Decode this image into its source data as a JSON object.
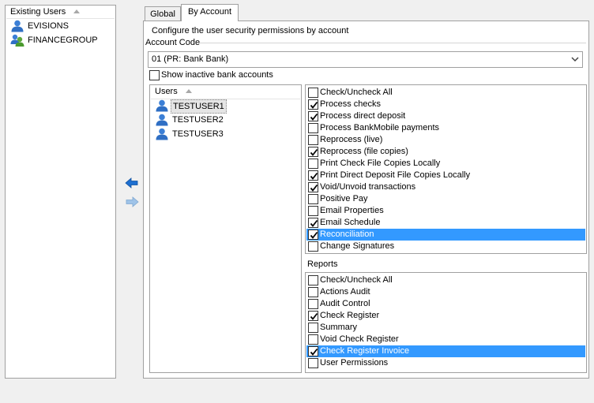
{
  "existing_users": {
    "header": "Existing Users",
    "items": [
      {
        "label": "EVISIONS",
        "type": "user-icon"
      },
      {
        "label": "FINANCEGROUP",
        "type": "group-icon"
      }
    ]
  },
  "tabs": [
    {
      "label": "Global",
      "active": false
    },
    {
      "label": "By Account",
      "active": true
    }
  ],
  "description": "Configure the user security permissions by account",
  "account_code": {
    "label": "Account Code",
    "value": "01 (PR: Bank Bank)"
  },
  "show_inactive": {
    "label": "Show inactive bank accounts",
    "checked": false
  },
  "users": {
    "header": "Users",
    "items": [
      {
        "label": "TESTUSER1",
        "selected": true
      },
      {
        "label": "TESTUSER2",
        "selected": false
      },
      {
        "label": "TESTUSER3",
        "selected": false
      }
    ]
  },
  "permissions": [
    {
      "label": "Check/Uncheck All",
      "checked": false,
      "selected": false
    },
    {
      "label": "Process checks",
      "checked": true,
      "selected": false
    },
    {
      "label": "Process direct deposit",
      "checked": true,
      "selected": false
    },
    {
      "label": "Process BankMobile payments",
      "checked": false,
      "selected": false
    },
    {
      "label": "Reprocess (live)",
      "checked": false,
      "selected": false
    },
    {
      "label": "Reprocess (file copies)",
      "checked": true,
      "selected": false
    },
    {
      "label": "Print Check File Copies Locally",
      "checked": false,
      "selected": false
    },
    {
      "label": "Print Direct Deposit File Copies Locally",
      "checked": true,
      "selected": false
    },
    {
      "label": "Void/Unvoid transactions",
      "checked": true,
      "selected": false
    },
    {
      "label": "Positive Pay",
      "checked": false,
      "selected": false
    },
    {
      "label": "Email Properties",
      "checked": false,
      "selected": false
    },
    {
      "label": "Email Schedule",
      "checked": true,
      "selected": false
    },
    {
      "label": "Reconciliation",
      "checked": true,
      "selected": true
    },
    {
      "label": "Change Signatures",
      "checked": false,
      "selected": false
    }
  ],
  "reports": {
    "label": "Reports",
    "items": [
      {
        "label": "Check/Uncheck All",
        "checked": false,
        "selected": false
      },
      {
        "label": "Actions Audit",
        "checked": false,
        "selected": false
      },
      {
        "label": "Audit Control",
        "checked": false,
        "selected": false
      },
      {
        "label": "Check Register",
        "checked": true,
        "selected": false
      },
      {
        "label": "Summary",
        "checked": false,
        "selected": false
      },
      {
        "label": "Void Check Register",
        "checked": false,
        "selected": false
      },
      {
        "label": "Check Register Invoice",
        "checked": true,
        "selected": true
      },
      {
        "label": "User Permissions",
        "checked": false,
        "selected": false
      }
    ]
  },
  "colors": {
    "selection": "#3399ff",
    "arrow_active": "#1e6fd0",
    "arrow_disabled": "#9fc3e8"
  }
}
